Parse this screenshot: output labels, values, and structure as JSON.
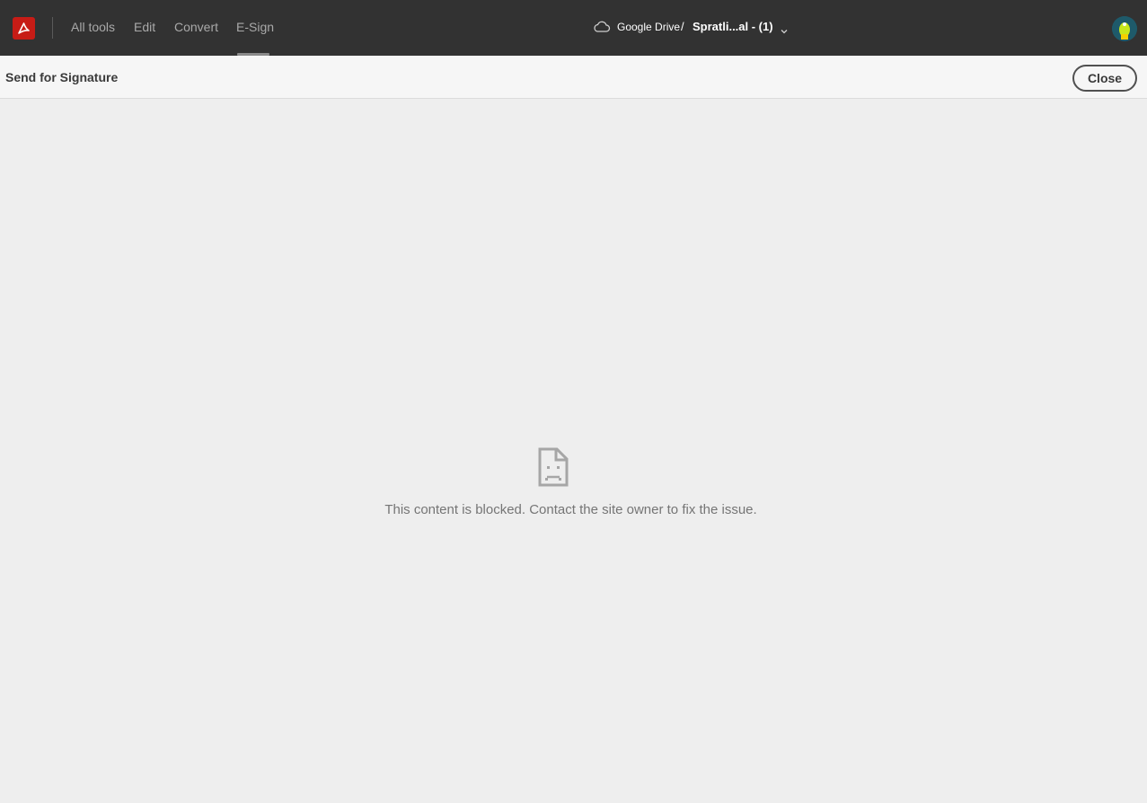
{
  "app": {
    "logo_icon": "acrobat-logo-icon",
    "brand_color": "#c71c16"
  },
  "nav": {
    "tabs": [
      {
        "label": "All tools"
      },
      {
        "label": "Edit"
      },
      {
        "label": "Convert"
      },
      {
        "label": "E-Sign",
        "active": true
      }
    ]
  },
  "breadcrumb": {
    "location_icon": "cloud-icon",
    "location": "Google Drive",
    "separator": "/",
    "file_name": "Spratli...al - (1)",
    "dropdown_icon": "chevron-down-icon"
  },
  "user": {
    "avatar_icon": "avatar"
  },
  "panel": {
    "title": "Send for Signature",
    "close_label": "Close"
  },
  "content": {
    "blocked_icon": "sad-document-icon",
    "message": "This content is blocked. Contact the site owner to fix the issue."
  }
}
